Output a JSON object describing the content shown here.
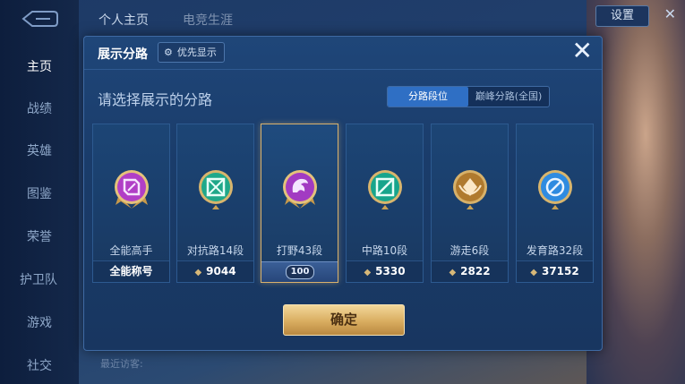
{
  "background": {
    "top_nav": [
      "个人主页",
      "电竞生涯"
    ],
    "sidebar_items": [
      "主页",
      "战绩",
      "英雄",
      "图鉴",
      "荣誉",
      "护卫队",
      "游戏",
      "社交"
    ],
    "settings_label": "设置",
    "visitors_label": "最近访客:"
  },
  "modal": {
    "title": "展示分路",
    "priority_label": "优先显示",
    "subtitle": "请选择展示的分路",
    "tabs": [
      "分路段位",
      "巅峰分路(全国)"
    ],
    "active_tab": 0,
    "cards": [
      {
        "name": "全能高手",
        "footer": "全能称号",
        "selected": false,
        "badge_color": "#b13fc6",
        "badge_icon": "all-round-icon"
      },
      {
        "name": "对抗路14段",
        "footer": "9044",
        "selected": false,
        "badge_color": "#1fa88a",
        "badge_icon": "clash-lane-icon"
      },
      {
        "name": "打野43段",
        "footer": "100",
        "selected": true,
        "badge_color": "#a23bc2",
        "badge_icon": "dragon-icon"
      },
      {
        "name": "中路10段",
        "footer": "5330",
        "selected": false,
        "badge_color": "#17a58c",
        "badge_icon": "mid-lane-icon"
      },
      {
        "name": "游走6段",
        "footer": "2822",
        "selected": false,
        "badge_color": "#b07a2e",
        "badge_icon": "roam-icon"
      },
      {
        "name": "发育路32段",
        "footer": "37152",
        "selected": false,
        "badge_color": "#2f8be0",
        "badge_icon": "farm-lane-icon"
      }
    ],
    "confirm_label": "确定"
  }
}
